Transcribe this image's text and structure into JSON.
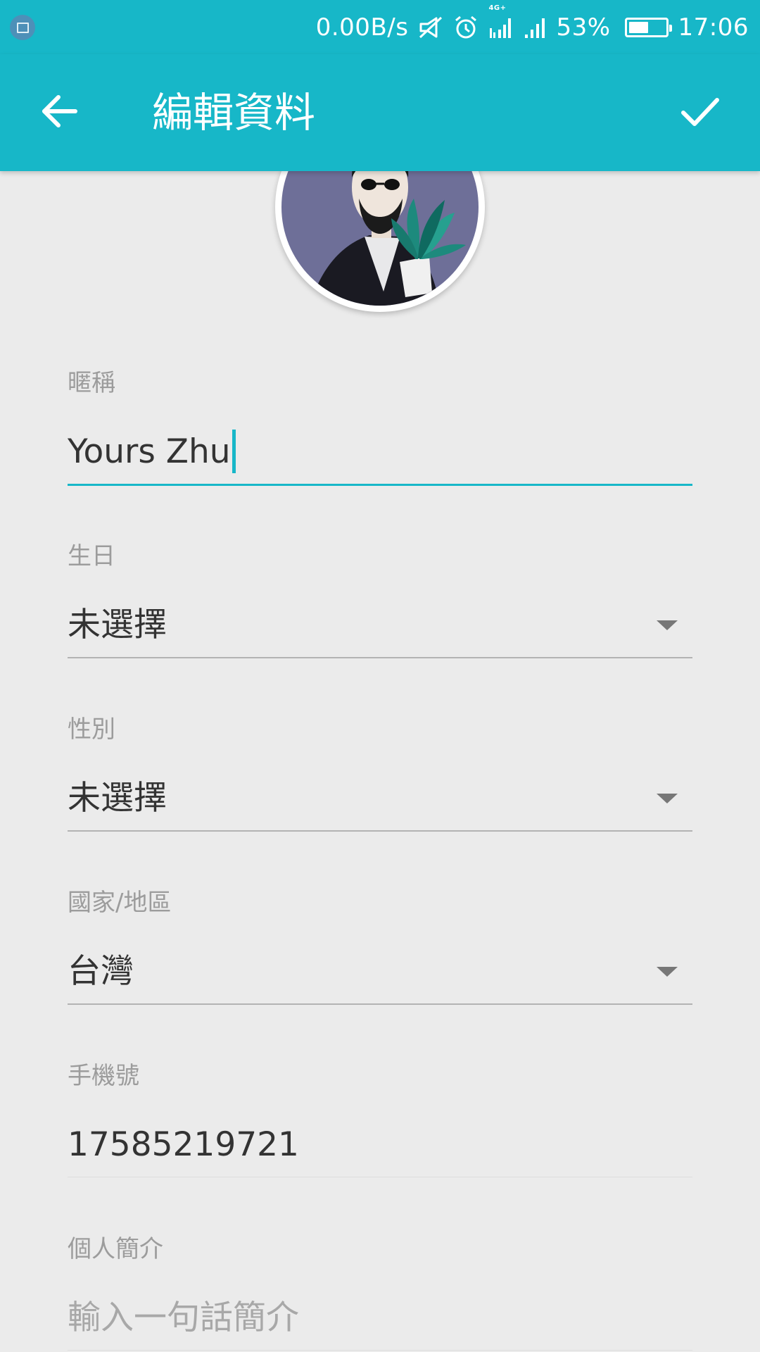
{
  "status_bar": {
    "network_speed": "0.00B/s",
    "network_type": "4G+",
    "battery_percent": "53%",
    "battery_level": 0.53,
    "time": "17:06",
    "icons": [
      "screenshot-icon",
      "mute-vibrate-icon",
      "alarm-icon",
      "signal-4g-icon",
      "signal-icon",
      "battery-icon"
    ]
  },
  "app_bar": {
    "title": "編輯資料",
    "back_icon": "arrow-left-icon",
    "done_icon": "check-icon"
  },
  "colors": {
    "accent": "#17b7c8",
    "background": "#ebebeb",
    "label": "#9c9c9c",
    "value": "#333333",
    "placeholder": "#a8a8a8"
  },
  "form": {
    "nickname": {
      "label": "暱稱",
      "value": "Yours Zhu"
    },
    "birthday": {
      "label": "生日",
      "value": "未選擇"
    },
    "gender": {
      "label": "性別",
      "value": "未選擇"
    },
    "region": {
      "label": "國家/地區",
      "value": "台灣"
    },
    "phone": {
      "label": "手機號",
      "value": "17585219721"
    },
    "bio": {
      "label": "個人簡介",
      "placeholder": "輸入一句話簡介"
    }
  }
}
